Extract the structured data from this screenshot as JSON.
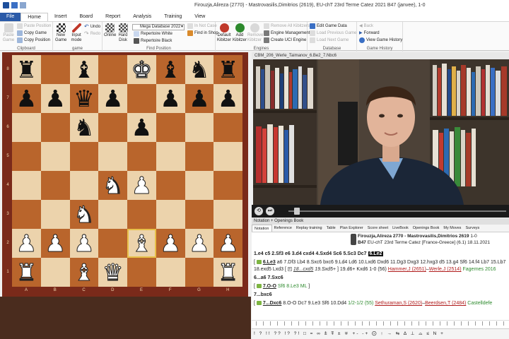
{
  "window": {
    "title": "Firouzja,Alireza (2770) - Mastrovasilis,Dimitrios (2619), EU-chT 23rd Terme Catez 2021  B47  (janvee), 1-0"
  },
  "menu": {
    "tabs": [
      "File",
      "Home",
      "Insert",
      "Board",
      "Report",
      "Analysis",
      "Training",
      "View"
    ]
  },
  "ribbon": {
    "clipboard": {
      "paste_game": "Paste Game",
      "paste_position": "Paste Position",
      "copy_game": "Copy Game",
      "copy_position": "Copy Position",
      "title": "Clipboard"
    },
    "game": {
      "new_game": "New Game",
      "input_mode": "Input mode",
      "undo": "Undo",
      "redo": "Redo",
      "title": "game"
    },
    "find_position": {
      "online": "Online",
      "hard_disk": "Hard Disk",
      "database": "Mega Database 2022",
      "rep_white": "Repertoire White",
      "rep_black": "Repertoire Black",
      "in_notcase": "In Not Case",
      "find_in_shop": "Find in Shop",
      "title": "Find Position"
    },
    "engines": {
      "default_kibitzer": "Default Kibitzer",
      "add_kibitzer": "Add Kibitzer",
      "remove_kibitzer": "Remove Kibitzer",
      "remove_all": "Remove All Kibitzers",
      "engine_mgmt": "Engine Management",
      "create_uci": "Create UCI Engine",
      "title": "Engines"
    },
    "database": {
      "edit_game_data": "Edit Game Data",
      "load_prev": "Load Previous Game",
      "load_next": "Load Next Game",
      "title": "Database"
    },
    "game_history": {
      "back": "Back",
      "forward": "Forward",
      "view_history": "View Game History",
      "title": "Game History"
    }
  },
  "board": {
    "ranks": [
      "8",
      "7",
      "6",
      "5",
      "4",
      "3",
      "2",
      "1"
    ],
    "files": [
      "A",
      "B",
      "C",
      "D",
      "E",
      "F",
      "G",
      "H"
    ],
    "rows": [
      [
        "br",
        "",
        "bb",
        "",
        "wk",
        "bb",
        "bn",
        "br"
      ],
      [
        "bp",
        "bp",
        "bq",
        "bp",
        "",
        "bp",
        "bp",
        "bp"
      ],
      [
        "",
        "",
        "bn",
        "",
        "bp",
        "",
        "",
        ""
      ],
      [
        "",
        "",
        "",
        "",
        "",
        "",
        "",
        ""
      ],
      [
        "",
        "",
        "",
        "wn",
        "wp",
        "",
        "",
        ""
      ],
      [
        "",
        "",
        "wn",
        "",
        "",
        "",
        "",
        ""
      ],
      [
        "wp",
        "wp",
        "wp",
        "",
        "wb",
        "wp",
        "wp",
        "wp"
      ],
      [
        "wr",
        "",
        "wb",
        "wq",
        "",
        "",
        "",
        "wr"
      ]
    ],
    "highlight": [
      [
        6,
        4
      ]
    ]
  },
  "video": {
    "title": "CBM_206_Werle_Taimanov_6.Be2_7.Nbc6"
  },
  "notation": {
    "header": "Notation + Openings Book",
    "tabs": [
      "Notation",
      "Reference",
      "Replay training",
      "Table",
      "Plan Explorer",
      "Score sheet",
      "LiveBook",
      "Openings Book",
      "My Moves",
      "Surveys"
    ],
    "game_players": "Firouzja,Alireza 2770 - Mastrovasilis,Dimitrios 2619",
    "game_result": "1-0",
    "game_eco": "B47",
    "game_event": "EU-chT 23rd Terme Catez [France-Greece] (6.1) 18.11.2021",
    "line1_moves": "1.e4 c5 2.Sf3 e6 3.d4 cxd4 4.Sxd4 Sc6 5.Sc3 Dc7",
    "line1_current": "6.Le2",
    "line2_start": "6.Le3",
    "line2_rest": "a6 7.Df3 Lb4 8.Sxc6 bxc6 9.Ld4 Ld6 10.Lxd6 Dxd6 11.Dg3 Dxg3 12.hxg3 d5 13.g4 Sf6 14.f4 Lb7 15.Lb7",
    "line3": "18.exd5 Lxd3",
    "line3_ref": "18...cxd5",
    "line3_ref2": "19.Sxd5+",
    "line3_tail": "19.d6+ Kxd6 1-0 (56)",
    "line3_player1": "Hammer,J (2651)",
    "line3_player2": "Werle,J (2514)",
    "line3_event": "Fagernes 2016",
    "line4": "6...a6 7.Sxc6",
    "line5_start": "7.O-O",
    "line5_rest": "Sf6 8.Le3 ML",
    "line6": "7...bxc6",
    "line7_start": "7...Dxc6",
    "line7_rest": "8.O-O Dc7 9.Le3 Sf6 10.Dd4",
    "line7_result": "1/2-1/2 (55)",
    "line7_player1": "Sethuraman,S (2620)",
    "line7_player2": "Beerdsen,T (2484)",
    "line7_event": "Castelldefe",
    "symbols": "!  ?  !!  ??  !?  ?!  □  =  ∞  ⩲  ⩱  ±  ∓  +-  -+  ⨀  ↑  →  ⇆  ∆  ⊥  ⌓  ≤  N  +"
  }
}
